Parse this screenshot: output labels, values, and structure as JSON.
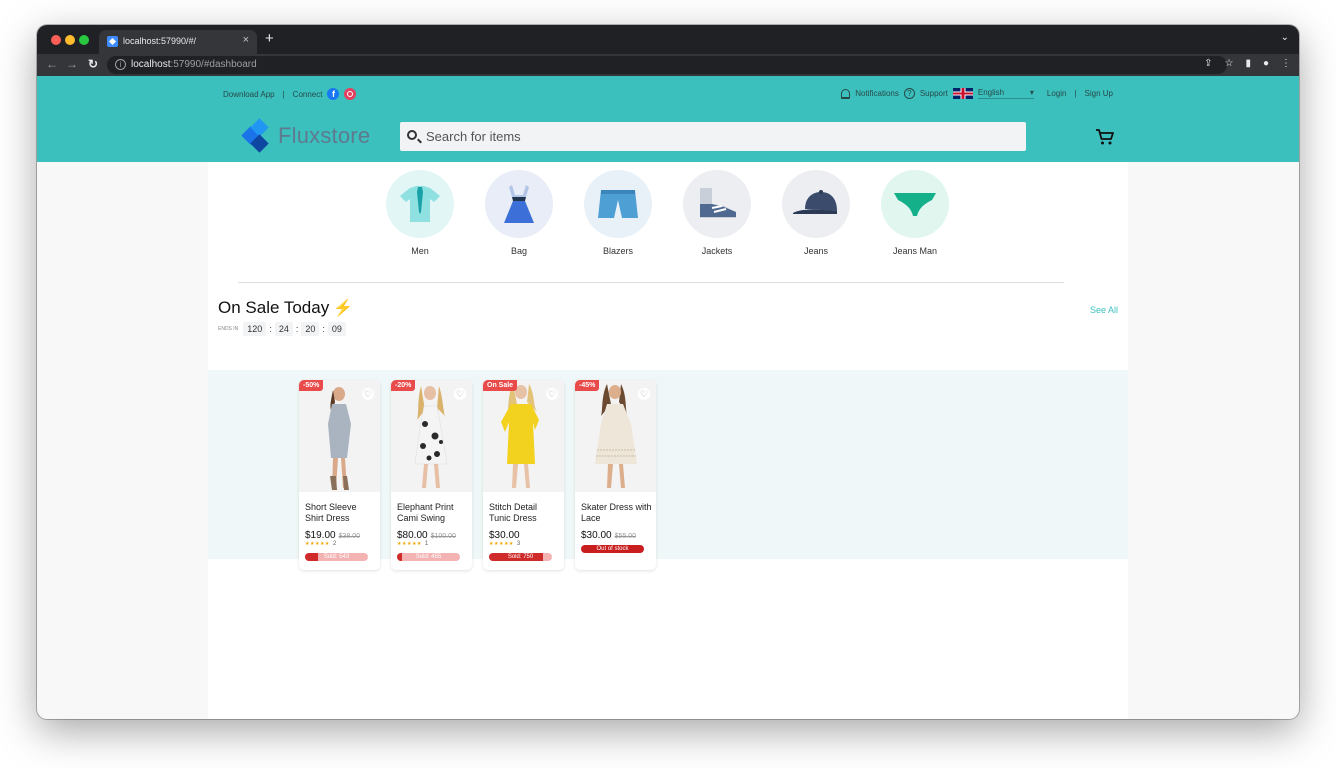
{
  "browser": {
    "tab_title": "localhost:57990/#/",
    "url_host": "localhost",
    "url_rest": ":57990/#dashboard"
  },
  "topbar": {
    "download_app": "Download App",
    "connect": "Connect",
    "notifications": "Notifications",
    "support": "Support",
    "language": "English",
    "login": "Login",
    "signup": "Sign Up"
  },
  "brand": {
    "name": "Fluxstore",
    "accent": "#3bc0be"
  },
  "search": {
    "placeholder": "Search for items"
  },
  "categories": [
    {
      "label": "Men",
      "icon": "shirt-tie-icon",
      "bg": "#e3f6f6"
    },
    {
      "label": "Bag",
      "icon": "dress-icon",
      "bg": "#e8edf7"
    },
    {
      "label": "Blazers",
      "icon": "shorts-icon",
      "bg": "#e8f1f8"
    },
    {
      "label": "Jackets",
      "icon": "sneaker-icon",
      "bg": "#eceef2"
    },
    {
      "label": "Jeans",
      "icon": "cap-icon",
      "bg": "#eceef2"
    },
    {
      "label": "Jeans Man",
      "icon": "underwear-icon",
      "bg": "#e2f6f0"
    }
  ],
  "sale": {
    "title": "On Sale Today",
    "ends_in": "ENDS IN",
    "timer": [
      "120",
      "24",
      "20",
      "09"
    ],
    "see_all": "See All"
  },
  "products": [
    {
      "badge": "-50%",
      "name": "Short Sleeve Shirt Dress",
      "price": "$19.00",
      "old_price": "$38.00",
      "stars": "★★★★★",
      "rating_count": "2",
      "sold": "Sold: 543",
      "sold_fraction": 0.2,
      "dress_color": "#aab4c0"
    },
    {
      "badge": "-20%",
      "name": "Elephant Print Cami Swing",
      "price": "$80.00",
      "old_price": "$100.00",
      "stars": "★★★★★",
      "rating_count": "1",
      "sold": "Sold: 455",
      "sold_fraction": 0.08,
      "dress_color": "#f4f4f4"
    },
    {
      "badge": "On Sale",
      "name": "Stitch Detail Tunic Dress",
      "price": "$30.00",
      "old_price": "",
      "stars": "★★★★★",
      "rating_count": "3",
      "sold": "Sold: 750",
      "sold_fraction": 0.85,
      "dress_color": "#f2d21f"
    },
    {
      "badge": "-45%",
      "name": "Skater Dress with Lace",
      "price": "$30.00",
      "old_price": "$55.00",
      "out_of_stock": "Out of stock",
      "dress_color": "#efe6da"
    }
  ]
}
